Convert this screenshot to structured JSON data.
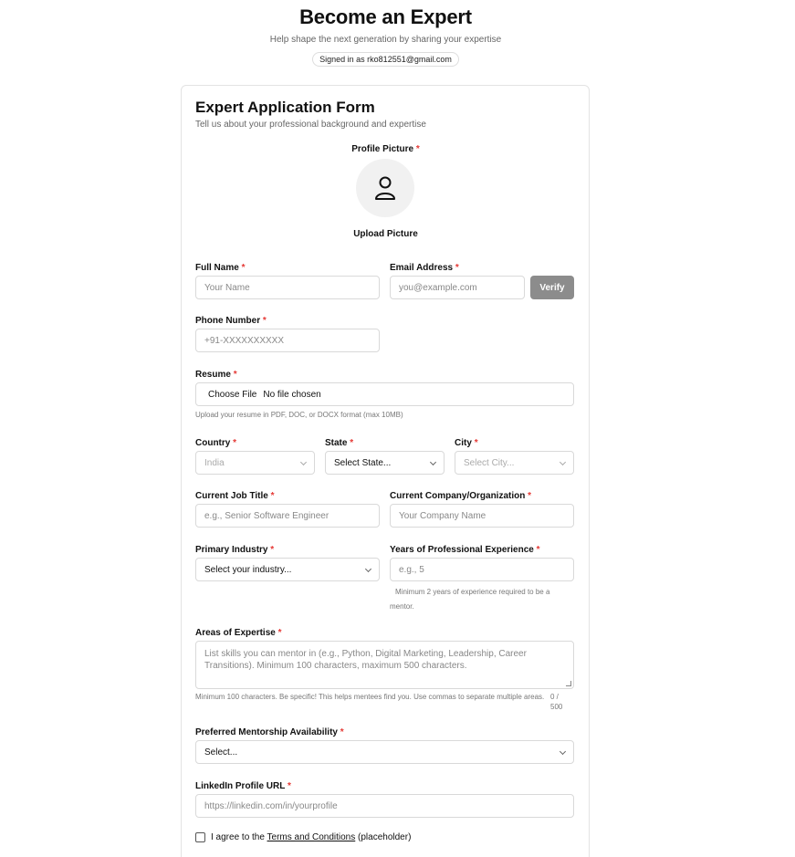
{
  "header": {
    "title": "Become an Expert",
    "subtitle": "Help shape the next generation by sharing your expertise",
    "signed_in": "Signed in as rko812551@gmail.com"
  },
  "form": {
    "title": "Expert Application Form",
    "subtitle": "Tell us about your professional background and expertise",
    "profile_picture_label": "Profile Picture",
    "upload_picture": "Upload Picture",
    "required_mark": "*",
    "full_name": {
      "label": "Full Name",
      "placeholder": "Your Name"
    },
    "email": {
      "label": "Email Address",
      "placeholder": "you@example.com",
      "verify": "Verify"
    },
    "phone": {
      "label": "Phone Number",
      "placeholder": "+91-XXXXXXXXXX"
    },
    "resume": {
      "label": "Resume",
      "button": "Choose File",
      "status": "No file chosen",
      "hint": "Upload your resume in PDF, DOC, or DOCX format (max 10MB)"
    },
    "country": {
      "label": "Country",
      "value": "India"
    },
    "state": {
      "label": "State",
      "value": "Select State..."
    },
    "city": {
      "label": "City",
      "value": "Select City..."
    },
    "job_title": {
      "label": "Current Job Title",
      "placeholder": "e.g., Senior Software Engineer"
    },
    "company": {
      "label": "Current Company/Organization",
      "placeholder": "Your Company Name"
    },
    "industry": {
      "label": "Primary Industry",
      "value": "Select your industry..."
    },
    "experience": {
      "label": "Years of Professional Experience",
      "placeholder": "e.g., 5",
      "hint": "Minimum 2 years of experience required to be a mentor."
    },
    "expertise": {
      "label": "Areas of Expertise",
      "placeholder": "List skills you can mentor in (e.g., Python, Digital Marketing, Leadership, Career Transitions). Minimum 100 characters, maximum 500 characters.",
      "hint": "Minimum 100 characters. Be specific! This helps mentees find you. Use commas to separate multiple areas.",
      "counter_current": "0 /",
      "counter_max": "500"
    },
    "availability": {
      "label": "Preferred Mentorship Availability",
      "value": "Select..."
    },
    "linkedin": {
      "label": "LinkedIn Profile URL",
      "placeholder": "https://linkedin.com/in/yourprofile"
    },
    "terms": {
      "prefix": "I agree to the ",
      "link": "Terms and Conditions",
      "suffix": " (placeholder)"
    }
  },
  "colors": {
    "required": "#e53935",
    "verify_bg": "#8c8c8c",
    "avatar_bg": "#f1f1f1"
  },
  "icons": {
    "avatar": "user-icon"
  }
}
